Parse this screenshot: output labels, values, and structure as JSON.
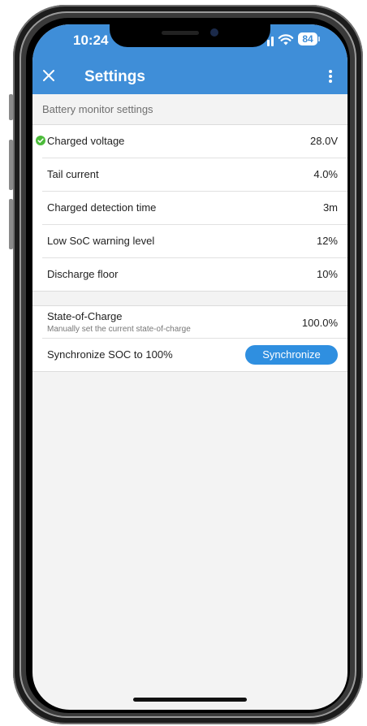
{
  "status_bar": {
    "time": "10:24",
    "battery": "84"
  },
  "header": {
    "title": "Settings"
  },
  "section": {
    "title": "Battery monitor settings"
  },
  "settings": [
    {
      "label": "Charged voltage",
      "value": "28.0V",
      "status": "ok"
    },
    {
      "label": "Tail current",
      "value": "4.0%"
    },
    {
      "label": "Charged detection time",
      "value": "3m"
    },
    {
      "label": "Low SoC warning level",
      "value": "12%"
    },
    {
      "label": "Discharge floor",
      "value": "10%"
    }
  ],
  "soc": {
    "label": "State-of-Charge",
    "description": "Manually set the current state-of-charge",
    "value": "100.0%"
  },
  "sync": {
    "label": "Synchronize SOC to 100%",
    "button_label": "Synchronize"
  },
  "colors": {
    "header": "#3f8ed8",
    "button": "#2f8fe0",
    "ok": "#4cbb3a",
    "background": "#f3f3f3"
  },
  "icons": [
    "close-icon",
    "more-vert-icon",
    "check-circle-icon",
    "wifi-icon",
    "cellular-signal-icon",
    "battery-icon"
  ]
}
